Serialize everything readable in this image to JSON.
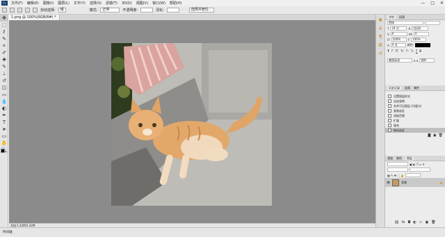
{
  "app": {
    "logo": "Ps",
    "menu": [
      "文件(F)",
      "编辑(E)",
      "图像(I)",
      "图层(L)",
      "文字(Y)",
      "选择(S)",
      "滤镜(T)",
      "3D(D)",
      "视图(V)",
      "窗口(W)",
      "帮助(H)"
    ],
    "window_controls": [
      "—",
      "□",
      "✕"
    ]
  },
  "options_bar": {
    "layer_select": "组",
    "auto_select_label": "自动选择:",
    "mode_label": "模式:",
    "mode_value": "正常",
    "opacity_label": "不透明度:",
    "feather_label": "羽化:",
    "select_mask_label": "选择并遮住..."
  },
  "document": {
    "tab_title": "1.png @ 100%(RGB/8#) *",
    "status": "文档:1.42M/1.42M"
  },
  "timeline": {
    "label": "时间轴"
  },
  "tools": [
    {
      "name": "move-tool",
      "glyph": "✥"
    },
    {
      "name": "marquee-tool",
      "glyph": "⬚"
    },
    {
      "name": "lasso-tool",
      "glyph": "ℓ"
    },
    {
      "name": "quick-select-tool",
      "glyph": "✎"
    },
    {
      "name": "crop-tool",
      "glyph": "⌗"
    },
    {
      "name": "eyedropper-tool",
      "glyph": "✐"
    },
    {
      "name": "healing-tool",
      "glyph": "✚"
    },
    {
      "name": "brush-tool",
      "glyph": "✎"
    },
    {
      "name": "stamp-tool",
      "glyph": "⊥"
    },
    {
      "name": "history-brush-tool",
      "glyph": "↺"
    },
    {
      "name": "eraser-tool",
      "glyph": "◫"
    },
    {
      "name": "gradient-tool",
      "glyph": "▭"
    },
    {
      "name": "blur-tool",
      "glyph": "💧"
    },
    {
      "name": "dodge-tool",
      "glyph": "◐"
    },
    {
      "name": "pen-tool",
      "glyph": "✒"
    },
    {
      "name": "type-tool",
      "glyph": "T"
    },
    {
      "name": "path-select-tool",
      "glyph": "➤"
    },
    {
      "name": "shape-tool",
      "glyph": "▭"
    },
    {
      "name": "hand-tool",
      "glyph": "✋"
    },
    {
      "name": "zoom-tool",
      "glyph": "🔍"
    }
  ],
  "character_panel": {
    "tabs": [
      "字符",
      "段落"
    ],
    "font_family": "黑体",
    "font_style": "-",
    "font_size": "24 点",
    "leading": "(自动)",
    "kerning": "0",
    "tracking": "0",
    "scale_v": "100%",
    "scale_h": "100%",
    "baseline": "0 点",
    "color_label": "颜色:",
    "language": "美国英语",
    "antialias": "锐利"
  },
  "history_panel": {
    "tabs": [
      "历史记录",
      "段落",
      "属性"
    ],
    "items": [
      "设置图层样式",
      "自由变换",
      "合并可见图层 (印盖为)",
      "复制选区",
      "选取范围",
      "扩展",
      "填充",
      "移动选区"
    ]
  },
  "layers_panel": {
    "tabs": [
      "通道",
      "路径",
      "图层"
    ],
    "layer_name": "背景"
  },
  "colors": {
    "canvas_bg": "#8b8b8b",
    "accent_icon": "#c58a2a"
  }
}
